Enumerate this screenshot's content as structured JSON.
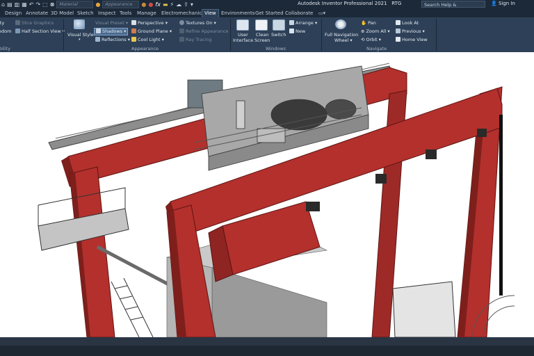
{
  "app": {
    "title": "Autodesk Inventor Professional 2021",
    "document": "RTG",
    "search_placeholder": "Search Help & Commands...",
    "sign_in": "Sign In"
  },
  "quick_access": {
    "material_placeholder": "Material",
    "appearance_placeholder": "Appearance",
    "formula_glyph": "fx"
  },
  "tabs": [
    {
      "label": "Design"
    },
    {
      "label": "Annotate"
    },
    {
      "label": "3D Model"
    },
    {
      "label": "Sketch"
    },
    {
      "label": "Inspect"
    },
    {
      "label": "Tools"
    },
    {
      "label": "Manage"
    },
    {
      "label": "Electromechanical"
    },
    {
      "label": "View",
      "active": true
    },
    {
      "label": "Environments"
    },
    {
      "label": "Get Started"
    },
    {
      "label": "Collaborate"
    }
  ],
  "ribbon": {
    "visibility": {
      "label": "bility",
      "item1": "ity",
      "item2": "edom",
      "slice_graphics": "Slice Graphics",
      "half_section_view": "Half Section View"
    },
    "appearance": {
      "label": "Appearance",
      "visual_style": "Visual Style",
      "visual_preset": "Visual Preset",
      "shadows": "Shadows",
      "reflections": "Reflections",
      "perspective": "Perspective",
      "ground_plane": "Ground Plane",
      "cool_light": "Cool Light",
      "textures_on": "Textures On",
      "refine_appearance": "Refine Appearance",
      "ray_tracing": "Ray Tracing"
    },
    "windows": {
      "label": "Windows",
      "user_interface_1": "User",
      "user_interface_2": "Interface",
      "clean_screen_1": "Clean",
      "clean_screen_2": "Screen",
      "switch": "Switch",
      "arrange": "Arrange",
      "new": "New"
    },
    "navigate": {
      "label": "Navigate",
      "full_nav_wheel_1": "Full Navigation",
      "full_nav_wheel_2": "Wheel",
      "pan": "Pan",
      "zoom_all": "Zoom All",
      "orbit": "Orbit",
      "look_at": "Look At",
      "previous": "Previous",
      "home_view": "Home View"
    }
  },
  "colors": {
    "titlebar": "#1c2938",
    "ribbon": "#2d4058",
    "crane_red": "#b3302c",
    "crane_red_dark": "#7e1f1c",
    "steel": "#8f8f8f",
    "container": "#9a9a9a"
  }
}
